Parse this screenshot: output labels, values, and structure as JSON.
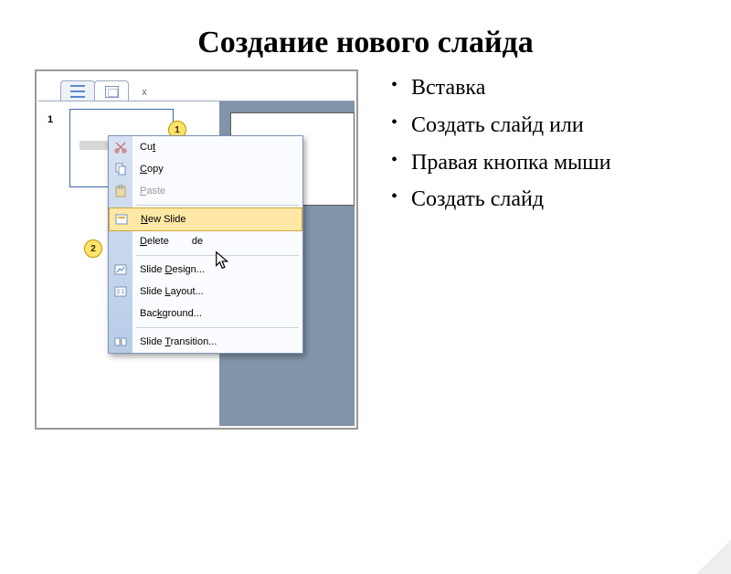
{
  "title": "Создание нового слайда",
  "bullets": [
    "Вставка",
    "Создать слайд или",
    "Правая кнопка мыши",
    "Создать слайд"
  ],
  "tabs": {
    "close": "x"
  },
  "panel": {
    "slide_number": "1"
  },
  "badges": {
    "one": "1",
    "two": "2"
  },
  "menu": {
    "cut_pre": "Cu",
    "cut_u": "t",
    "cut_post": "",
    "copy_pre": "",
    "copy_u": "C",
    "copy_post": "opy",
    "paste_pre": "",
    "paste_u": "P",
    "paste_post": "aste",
    "new_pre": "",
    "new_u": "N",
    "new_post": "ew Slide",
    "del_pre": "",
    "del_u": "D",
    "del_mid": "elete ",
    "del_icon_gap": "",
    "del_post": "de",
    "design_pre": "Slide ",
    "design_u": "D",
    "design_post": "esign...",
    "layout_pre": "Slide ",
    "layout_u": "L",
    "layout_post": "ayout...",
    "bg_pre": "Bac",
    "bg_u": "k",
    "bg_post": "ground...",
    "trans_pre": "Slide ",
    "trans_u": "T",
    "trans_post": "ransition..."
  }
}
